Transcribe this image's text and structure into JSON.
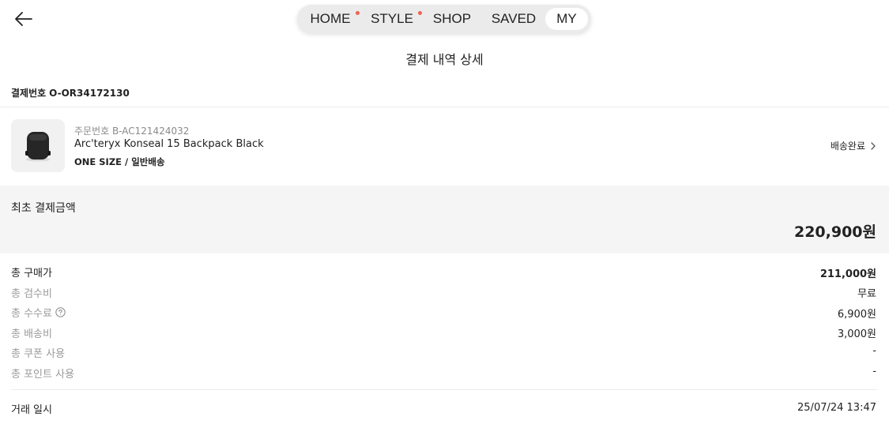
{
  "header": {
    "nav_tabs": [
      {
        "label": "HOME",
        "has_dot": true
      },
      {
        "label": "STYLE",
        "has_dot": true
      },
      {
        "label": "SHOP",
        "has_dot": false
      },
      {
        "label": "SAVED",
        "has_dot": false
      },
      {
        "label": "MY",
        "active": true
      }
    ],
    "dot_color": "#ef6253",
    "back_icon": "arrow-left-icon"
  },
  "page": {
    "title": "결제 내역 상세",
    "order_label": "결제번호",
    "order_number": "O-OR34172130"
  },
  "product": {
    "order_code": "주문번호 B-AC121424032",
    "name": "Arc'teryx Konseal 15 Backpack Black",
    "option": "ONE SIZE / 일반배송",
    "status": "배송완료",
    "image_icon": "black-backpack-image"
  },
  "summary": {
    "label": "최초 결제금액",
    "amount": "220,900원"
  },
  "breakdown": [
    {
      "label": "총 구매가",
      "value": "211,000원"
    },
    {
      "label": "총 검수비",
      "value": "무료"
    },
    {
      "label": "총 수수료",
      "value": "6,900원"
    },
    {
      "label": "총 배송비",
      "value": "3,000원"
    },
    {
      "label": "총 쿠폰 사용",
      "value": "-"
    },
    {
      "label": "총 포인트 사용",
      "value": "-"
    }
  ],
  "transaction": {
    "label": "거래 일시",
    "value": "25/07/24 13:47"
  }
}
